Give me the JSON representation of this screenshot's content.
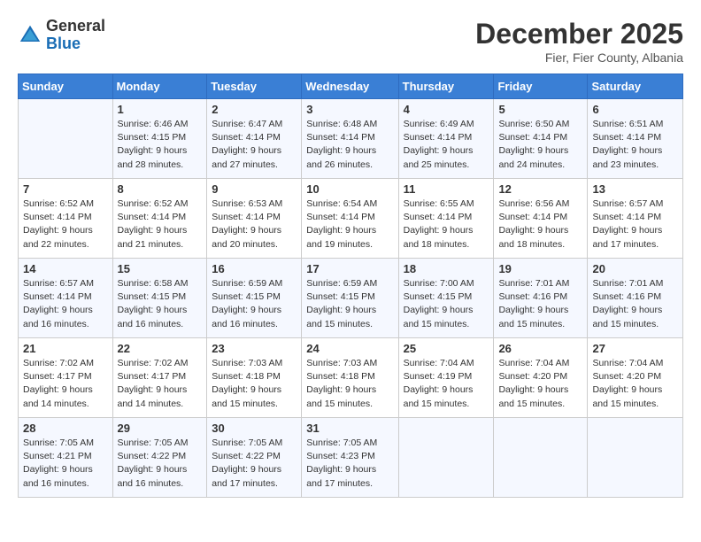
{
  "logo": {
    "general": "General",
    "blue": "Blue"
  },
  "header": {
    "month": "December 2025",
    "location": "Fier, Fier County, Albania"
  },
  "days_of_week": [
    "Sunday",
    "Monday",
    "Tuesday",
    "Wednesday",
    "Thursday",
    "Friday",
    "Saturday"
  ],
  "weeks": [
    [
      {
        "day": "",
        "sunrise": "",
        "sunset": "",
        "daylight": ""
      },
      {
        "day": "1",
        "sunrise": "Sunrise: 6:46 AM",
        "sunset": "Sunset: 4:15 PM",
        "daylight": "Daylight: 9 hours and 28 minutes."
      },
      {
        "day": "2",
        "sunrise": "Sunrise: 6:47 AM",
        "sunset": "Sunset: 4:14 PM",
        "daylight": "Daylight: 9 hours and 27 minutes."
      },
      {
        "day": "3",
        "sunrise": "Sunrise: 6:48 AM",
        "sunset": "Sunset: 4:14 PM",
        "daylight": "Daylight: 9 hours and 26 minutes."
      },
      {
        "day": "4",
        "sunrise": "Sunrise: 6:49 AM",
        "sunset": "Sunset: 4:14 PM",
        "daylight": "Daylight: 9 hours and 25 minutes."
      },
      {
        "day": "5",
        "sunrise": "Sunrise: 6:50 AM",
        "sunset": "Sunset: 4:14 PM",
        "daylight": "Daylight: 9 hours and 24 minutes."
      },
      {
        "day": "6",
        "sunrise": "Sunrise: 6:51 AM",
        "sunset": "Sunset: 4:14 PM",
        "daylight": "Daylight: 9 hours and 23 minutes."
      }
    ],
    [
      {
        "day": "7",
        "sunrise": "Sunrise: 6:52 AM",
        "sunset": "Sunset: 4:14 PM",
        "daylight": "Daylight: 9 hours and 22 minutes."
      },
      {
        "day": "8",
        "sunrise": "Sunrise: 6:52 AM",
        "sunset": "Sunset: 4:14 PM",
        "daylight": "Daylight: 9 hours and 21 minutes."
      },
      {
        "day": "9",
        "sunrise": "Sunrise: 6:53 AM",
        "sunset": "Sunset: 4:14 PM",
        "daylight": "Daylight: 9 hours and 20 minutes."
      },
      {
        "day": "10",
        "sunrise": "Sunrise: 6:54 AM",
        "sunset": "Sunset: 4:14 PM",
        "daylight": "Daylight: 9 hours and 19 minutes."
      },
      {
        "day": "11",
        "sunrise": "Sunrise: 6:55 AM",
        "sunset": "Sunset: 4:14 PM",
        "daylight": "Daylight: 9 hours and 18 minutes."
      },
      {
        "day": "12",
        "sunrise": "Sunrise: 6:56 AM",
        "sunset": "Sunset: 4:14 PM",
        "daylight": "Daylight: 9 hours and 18 minutes."
      },
      {
        "day": "13",
        "sunrise": "Sunrise: 6:57 AM",
        "sunset": "Sunset: 4:14 PM",
        "daylight": "Daylight: 9 hours and 17 minutes."
      }
    ],
    [
      {
        "day": "14",
        "sunrise": "Sunrise: 6:57 AM",
        "sunset": "Sunset: 4:14 PM",
        "daylight": "Daylight: 9 hours and 16 minutes."
      },
      {
        "day": "15",
        "sunrise": "Sunrise: 6:58 AM",
        "sunset": "Sunset: 4:15 PM",
        "daylight": "Daylight: 9 hours and 16 minutes."
      },
      {
        "day": "16",
        "sunrise": "Sunrise: 6:59 AM",
        "sunset": "Sunset: 4:15 PM",
        "daylight": "Daylight: 9 hours and 16 minutes."
      },
      {
        "day": "17",
        "sunrise": "Sunrise: 6:59 AM",
        "sunset": "Sunset: 4:15 PM",
        "daylight": "Daylight: 9 hours and 15 minutes."
      },
      {
        "day": "18",
        "sunrise": "Sunrise: 7:00 AM",
        "sunset": "Sunset: 4:15 PM",
        "daylight": "Daylight: 9 hours and 15 minutes."
      },
      {
        "day": "19",
        "sunrise": "Sunrise: 7:01 AM",
        "sunset": "Sunset: 4:16 PM",
        "daylight": "Daylight: 9 hours and 15 minutes."
      },
      {
        "day": "20",
        "sunrise": "Sunrise: 7:01 AM",
        "sunset": "Sunset: 4:16 PM",
        "daylight": "Daylight: 9 hours and 15 minutes."
      }
    ],
    [
      {
        "day": "21",
        "sunrise": "Sunrise: 7:02 AM",
        "sunset": "Sunset: 4:17 PM",
        "daylight": "Daylight: 9 hours and 14 minutes."
      },
      {
        "day": "22",
        "sunrise": "Sunrise: 7:02 AM",
        "sunset": "Sunset: 4:17 PM",
        "daylight": "Daylight: 9 hours and 14 minutes."
      },
      {
        "day": "23",
        "sunrise": "Sunrise: 7:03 AM",
        "sunset": "Sunset: 4:18 PM",
        "daylight": "Daylight: 9 hours and 15 minutes."
      },
      {
        "day": "24",
        "sunrise": "Sunrise: 7:03 AM",
        "sunset": "Sunset: 4:18 PM",
        "daylight": "Daylight: 9 hours and 15 minutes."
      },
      {
        "day": "25",
        "sunrise": "Sunrise: 7:04 AM",
        "sunset": "Sunset: 4:19 PM",
        "daylight": "Daylight: 9 hours and 15 minutes."
      },
      {
        "day": "26",
        "sunrise": "Sunrise: 7:04 AM",
        "sunset": "Sunset: 4:20 PM",
        "daylight": "Daylight: 9 hours and 15 minutes."
      },
      {
        "day": "27",
        "sunrise": "Sunrise: 7:04 AM",
        "sunset": "Sunset: 4:20 PM",
        "daylight": "Daylight: 9 hours and 15 minutes."
      }
    ],
    [
      {
        "day": "28",
        "sunrise": "Sunrise: 7:05 AM",
        "sunset": "Sunset: 4:21 PM",
        "daylight": "Daylight: 9 hours and 16 minutes."
      },
      {
        "day": "29",
        "sunrise": "Sunrise: 7:05 AM",
        "sunset": "Sunset: 4:22 PM",
        "daylight": "Daylight: 9 hours and 16 minutes."
      },
      {
        "day": "30",
        "sunrise": "Sunrise: 7:05 AM",
        "sunset": "Sunset: 4:22 PM",
        "daylight": "Daylight: 9 hours and 17 minutes."
      },
      {
        "day": "31",
        "sunrise": "Sunrise: 7:05 AM",
        "sunset": "Sunset: 4:23 PM",
        "daylight": "Daylight: 9 hours and 17 minutes."
      },
      {
        "day": "",
        "sunrise": "",
        "sunset": "",
        "daylight": ""
      },
      {
        "day": "",
        "sunrise": "",
        "sunset": "",
        "daylight": ""
      },
      {
        "day": "",
        "sunrise": "",
        "sunset": "",
        "daylight": ""
      }
    ]
  ]
}
